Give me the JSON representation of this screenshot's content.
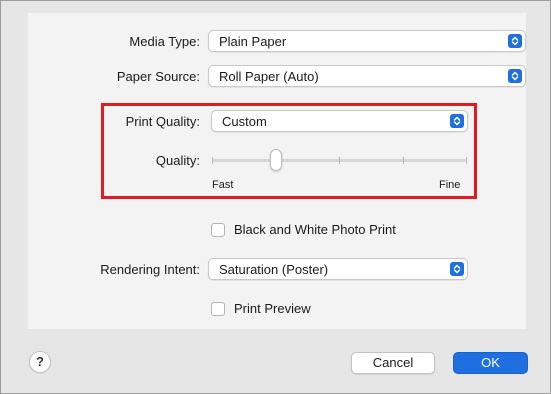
{
  "media_type": {
    "label": "Media Type:",
    "value": "Plain Paper"
  },
  "paper_source": {
    "label": "Paper Source:",
    "value": "Roll Paper (Auto)"
  },
  "print_quality": {
    "label": "Print Quality:",
    "value": "Custom"
  },
  "quality_slider": {
    "label": "Quality:",
    "min_label": "Fast",
    "max_label": "Fine",
    "steps": 5,
    "selected_step": 2
  },
  "black_white_photo": {
    "label": "Black and White Photo Print",
    "checked": false
  },
  "rendering_intent": {
    "label": "Rendering Intent:",
    "value": "Saturation (Poster)"
  },
  "print_preview": {
    "label": "Print Preview",
    "checked": false
  },
  "footer": {
    "help_label": "?",
    "cancel_label": "Cancel",
    "ok_label": "OK"
  },
  "colors": {
    "accent": "#1f6fe0",
    "highlight_border": "#e21a23"
  }
}
